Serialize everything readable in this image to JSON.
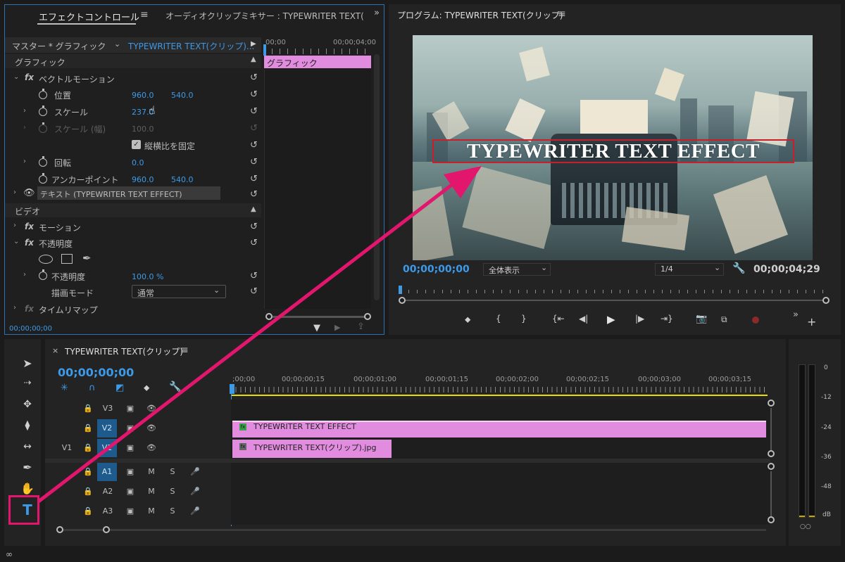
{
  "effect_controls": {
    "tab_title": "エフェクトコントロール",
    "tab_mixer": "オーディオクリップミキサー : TYPEWRITER TEXT(",
    "master_label": "マスター * グラフィック",
    "clip_label": "TYPEWRITER TEXT(クリップ)...",
    "ruler_start": "00;00",
    "ruler_end": "00;00;04;00",
    "section_graphic": "グラフィック",
    "vector_motion": "ベクトルモーション",
    "position_label": "位置",
    "position_x": "960.0",
    "position_y": "540.0",
    "scale_label": "スケール",
    "scale_value": "237.0",
    "scale_width_label": "スケール (幅)",
    "scale_width_value": "100.0",
    "uniform_scale_label": "縦横比を固定",
    "rotation_label": "回転",
    "rotation_value": "0.0",
    "anchor_label": "アンカーポイント",
    "anchor_x": "960.0",
    "anchor_y": "540.0",
    "text_layer": "テキスト (TYPEWRITER TEXT EFFECT)",
    "section_video": "ビデオ",
    "motion": "モーション",
    "opacity_group": "不透明度",
    "opacity_label": "不透明度",
    "opacity_value": "100.0 %",
    "blend_label": "描画モード",
    "blend_value": "通常",
    "time_remap": "タイムリマップ",
    "clip_bar_label": "グラフィック",
    "timecode": "00;00;00;00",
    "fx": "fx"
  },
  "program": {
    "title": "プログラム: TYPEWRITER TEXT(クリップ)",
    "overlay_text": "TYPEWRITER TEXT EFFECT",
    "timecode_current": "00;00;00;00",
    "zoom": "全体表示",
    "resolution": "1/4",
    "timecode_duration": "00;00;04;29"
  },
  "timeline": {
    "title": "TYPEWRITER TEXT(クリップ)",
    "timecode": "00;00;00;00",
    "ruler": [
      ";00;00",
      "00;00;00;15",
      "00;00;01;00",
      "00;00;01;15",
      "00;00;02;00",
      "00;00;02;15",
      "00;00;03;00",
      "00;00;03;15"
    ],
    "tracks": [
      {
        "name": "V3",
        "source": ""
      },
      {
        "name": "V2",
        "source": ""
      },
      {
        "name": "V1",
        "source": "V1"
      },
      {
        "name": "A1",
        "source": "",
        "m": "M",
        "s": "S"
      },
      {
        "name": "A2",
        "source": "",
        "m": "M",
        "s": "S"
      },
      {
        "name": "A3",
        "source": "",
        "m": "M",
        "s": "S"
      }
    ],
    "clip_v2": "TYPEWRITER TEXT EFFECT",
    "clip_v1": "TYPEWRITER TEXT(クリップ).jpg"
  },
  "meter": {
    "labels": [
      "0",
      "-12",
      "-24",
      "-36",
      "-48",
      "dB"
    ]
  },
  "colors": {
    "accent_blue": "#3d9ae8",
    "clip_pink": "#e28ce0",
    "annotation_magenta": "#e3166e",
    "timeline_yellow": "#e8e000"
  }
}
